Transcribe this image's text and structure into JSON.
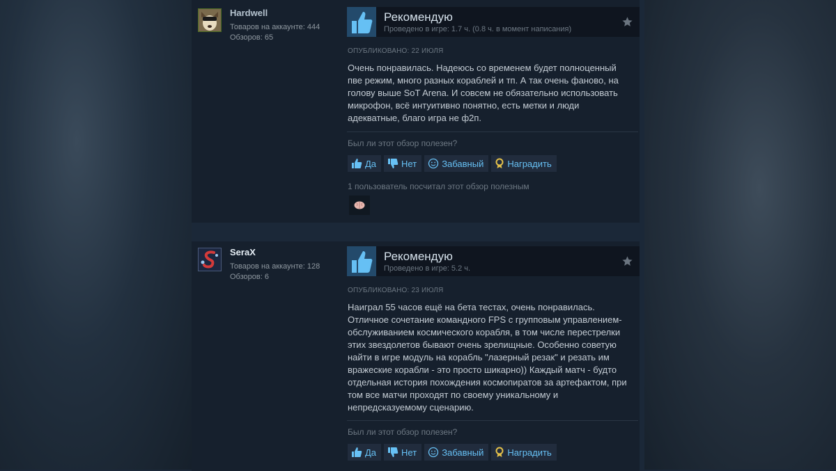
{
  "reviews": [
    {
      "username": "Hardwell",
      "products": "Товаров на аккаунте: 444",
      "reviews_count": "Обзоров: 65",
      "verdict": "Рекомендую",
      "playtime": "Проведено в игре: 1.7 ч. (0.8 ч. в момент написания)",
      "posted": "ОПУБЛИКОВАНО: 22 ИЮЛЯ",
      "text": "Очень понравилась. Надеюсь со временем будет полноценный пве режим, много разных кораблей и тп. А так очень фаново, на голову выше SoT Arena. И совсем не обязательно использовать микрофон, всё интуитивно понятно, есть метки и люди адекватные, благо игра не ф2п.",
      "helpful_question": "Был ли этот обзор полезен?",
      "btn_yes": "Да",
      "btn_no": "Нет",
      "btn_funny": "Забавный",
      "btn_award": "Наградить",
      "found_helpful": "1 пользователь посчитал этот обзор полезным"
    },
    {
      "username": "SeraX",
      "products": "Товаров на аккаунте: 128",
      "reviews_count": "Обзоров: 6",
      "verdict": "Рекомендую",
      "playtime": "Проведено в игре: 5.2 ч.",
      "posted": "ОПУБЛИКОВАНО: 23 ИЮЛЯ",
      "text": "Наиграл 55 часов ещё на бета тестах, очень понравилась. Отличное сочетание командного FPS с групповым управлением-обслуживанием космического корабля, в том числе перестрелки этих звездолетов бывают очень зрелищные. Особенно советую найти в игре модуль на корабль \"лазерный резак\" и резать им вражеские корабли - это просто шикарно)) Каждый матч - будто отдельная история похождения космопиратов за артефактом, при том все матчи проходят по своему уникальному и непредсказуемому сценарию.",
      "helpful_question": "Был ли этот обзор полезен?",
      "btn_yes": "Да",
      "btn_no": "Нет",
      "btn_funny": "Забавный",
      "btn_award": "Наградить"
    }
  ],
  "colors": {
    "page_bg": "#1b2838",
    "panel_bg": "#16202d",
    "link_blue": "#67c1f5",
    "thumb_box": "#234a6b"
  },
  "icons": [
    "thumbs-up-icon",
    "thumbs-down-icon",
    "smile-icon",
    "award-icon",
    "star-icon",
    "brain-award-icon"
  ]
}
